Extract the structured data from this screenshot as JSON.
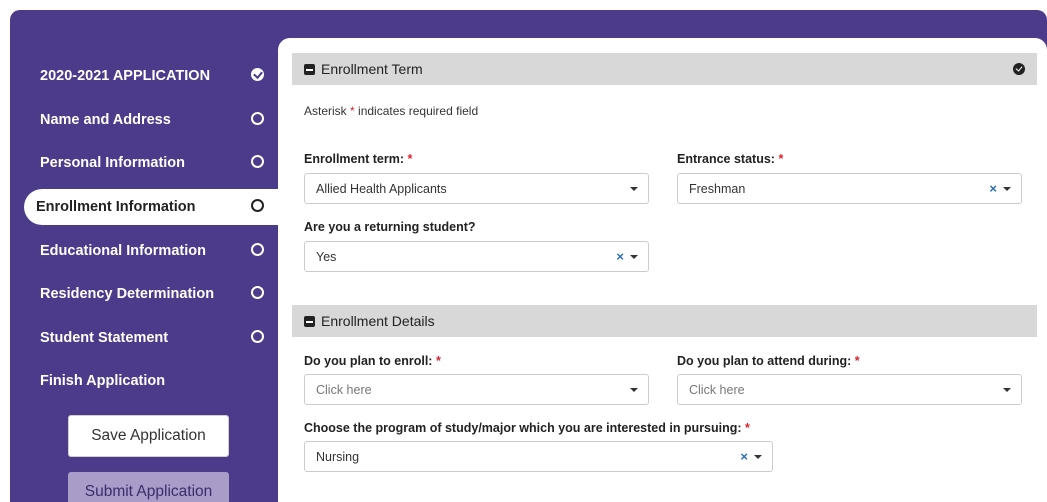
{
  "sidebar": {
    "items": [
      {
        "label": "2020-2021 APPLICATION",
        "status": "complete"
      },
      {
        "label": "Name and Address",
        "status": "incomplete"
      },
      {
        "label": "Personal Information",
        "status": "incomplete"
      },
      {
        "label": "Enrollment Information",
        "status": "current"
      },
      {
        "label": "Educational Information",
        "status": "incomplete"
      },
      {
        "label": "Residency Determination",
        "status": "incomplete"
      },
      {
        "label": "Student Statement",
        "status": "incomplete"
      },
      {
        "label": "Finish Application",
        "status": "none"
      }
    ],
    "save_label": "Save Application",
    "submit_label": "Submit Application"
  },
  "sections": {
    "term": {
      "title": "Enrollment Term",
      "note_prefix": "Asterisk",
      "note_star": "*",
      "note_suffix": "indicates required field",
      "enrollment_term_label": "Enrollment term:",
      "enrollment_term_value": "Allied Health Applicants",
      "entrance_status_label": "Entrance status:",
      "entrance_status_value": "Freshman",
      "returning_label": "Are you a returning student?",
      "returning_value": "Yes"
    },
    "details": {
      "title": "Enrollment Details",
      "plan_enroll_label": "Do you plan to enroll:",
      "plan_enroll_placeholder": "Click here",
      "plan_attend_label": "Do you plan to attend during:",
      "plan_attend_placeholder": "Click here",
      "program_label": "Choose the program of study/major which you are interested in pursuing:",
      "program_value": "Nursing"
    }
  },
  "required_mark": "*",
  "clear_glyph": "×",
  "colors": {
    "brand_purple": "#4c3a8a",
    "section_gray": "#d8d8d8",
    "required_red": "#d9232d",
    "clear_blue": "#2a6fb5"
  }
}
